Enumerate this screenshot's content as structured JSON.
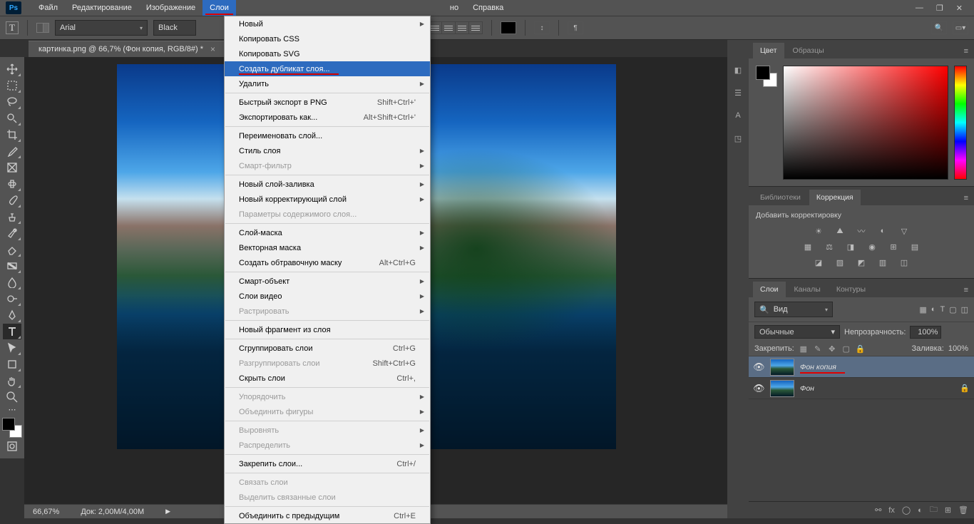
{
  "menubar": {
    "items": [
      "Файл",
      "Редактирование",
      "Изображение",
      "Слои",
      "но",
      "Справка"
    ],
    "active_index": 3
  },
  "winctl": {
    "min": "—",
    "max": "❐",
    "close": "✕"
  },
  "optionsbar": {
    "tool_letter": "T",
    "font": "Arial",
    "color_label": "Black"
  },
  "tab": {
    "title": "картинка.png @ 66,7% (Фон копия, RGB/8#) *"
  },
  "dropdown": {
    "groups": [
      [
        {
          "label": "Новый",
          "sub": true
        },
        {
          "label": "Копировать CSS"
        },
        {
          "label": "Копировать SVG"
        },
        {
          "label": "Создать дубликат слоя...",
          "highlighted": true,
          "redUnderline": true
        },
        {
          "label": "Удалить",
          "sub": true
        }
      ],
      [
        {
          "label": "Быстрый экспорт в PNG",
          "shortcut": "Shift+Ctrl+'"
        },
        {
          "label": "Экспортировать как...",
          "shortcut": "Alt+Shift+Ctrl+'"
        }
      ],
      [
        {
          "label": "Переименовать слой..."
        },
        {
          "label": "Стиль слоя",
          "sub": true
        },
        {
          "label": "Смарт-фильтр",
          "sub": true,
          "disabled": true
        }
      ],
      [
        {
          "label": "Новый слой-заливка",
          "sub": true
        },
        {
          "label": "Новый корректирующий слой",
          "sub": true
        },
        {
          "label": "Параметры содержимого слоя...",
          "disabled": true
        }
      ],
      [
        {
          "label": "Слой-маска",
          "sub": true
        },
        {
          "label": "Векторная маска",
          "sub": true
        },
        {
          "label": "Создать обтравочную маску",
          "shortcut": "Alt+Ctrl+G"
        }
      ],
      [
        {
          "label": "Смарт-объект",
          "sub": true
        },
        {
          "label": "Слои видео",
          "sub": true
        },
        {
          "label": "Растрировать",
          "sub": true,
          "disabled": true
        }
      ],
      [
        {
          "label": "Новый фрагмент из слоя"
        }
      ],
      [
        {
          "label": "Сгруппировать слои",
          "shortcut": "Ctrl+G"
        },
        {
          "label": "Разгруппировать слои",
          "shortcut": "Shift+Ctrl+G",
          "disabled": true
        },
        {
          "label": "Скрыть слои",
          "shortcut": "Ctrl+,"
        }
      ],
      [
        {
          "label": "Упорядочить",
          "sub": true,
          "disabled": true
        },
        {
          "label": "Объединить фигуры",
          "sub": true,
          "disabled": true
        }
      ],
      [
        {
          "label": "Выровнять",
          "sub": true,
          "disabled": true
        },
        {
          "label": "Распределить",
          "sub": true,
          "disabled": true
        }
      ],
      [
        {
          "label": "Закрепить слои...",
          "shortcut": "Ctrl+/"
        }
      ],
      [
        {
          "label": "Связать слои",
          "disabled": true
        },
        {
          "label": "Выделить связанные слои",
          "disabled": true
        }
      ],
      [
        {
          "label": "Объединить с предыдущим",
          "shortcut": "Ctrl+E"
        }
      ]
    ]
  },
  "statusbar": {
    "zoom": "66,67%",
    "doc": "Док: 2,00M/4,00M"
  },
  "panels": {
    "color_tabs": [
      "Цвет",
      "Образцы"
    ],
    "lib_tabs": [
      "Библиотеки",
      "Коррекция"
    ],
    "adj_label": "Добавить корректировку",
    "layer_tabs": [
      "Слои",
      "Каналы",
      "Контуры"
    ],
    "layer_search_placeholder": "Вид",
    "blend_mode": "Обычные",
    "opacity_label": "Непрозрачность:",
    "opacity_val": "100%",
    "lock_label": "Закрепить:",
    "fill_label": "Заливка:",
    "fill_val": "100%",
    "layers": [
      {
        "name": "Фон копия",
        "selected": true,
        "redUnderline": true
      },
      {
        "name": "Фон",
        "locked": true
      }
    ]
  }
}
